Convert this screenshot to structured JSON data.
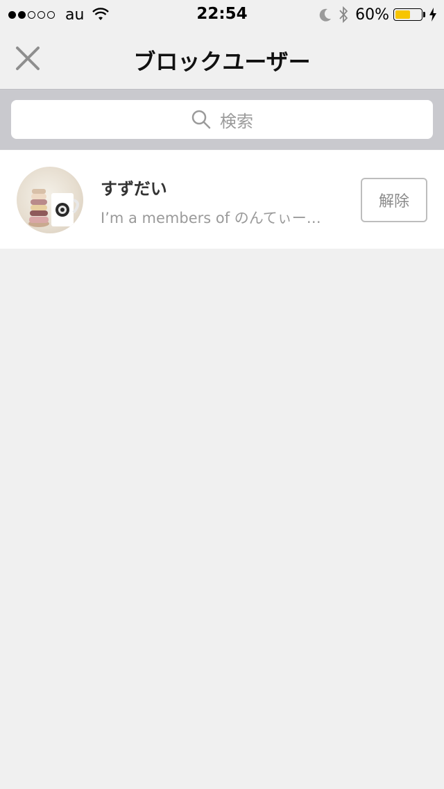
{
  "status_bar": {
    "carrier": "au",
    "time": "22:54",
    "battery": "60%",
    "battery_level": 0.6,
    "signal_bars_filled": 2,
    "signal_bars_total": 5,
    "icons": [
      "wifi-icon",
      "moon-icon",
      "bluetooth-icon",
      "battery-icon",
      "charging-icon"
    ]
  },
  "nav": {
    "title": "ブロックユーザー",
    "close_icon": "close-icon"
  },
  "search": {
    "placeholder": "検索",
    "icon": "search-icon"
  },
  "blocked_users": [
    {
      "name": "すずだい",
      "bio": "I’m a members of のんてぃー…",
      "action_label": "解除"
    }
  ],
  "colors": {
    "background": "#f0f0f0",
    "search_bar_bg": "#c9c9ce",
    "battery": "#f7c500",
    "secondary_text": "#9a9a9a"
  }
}
